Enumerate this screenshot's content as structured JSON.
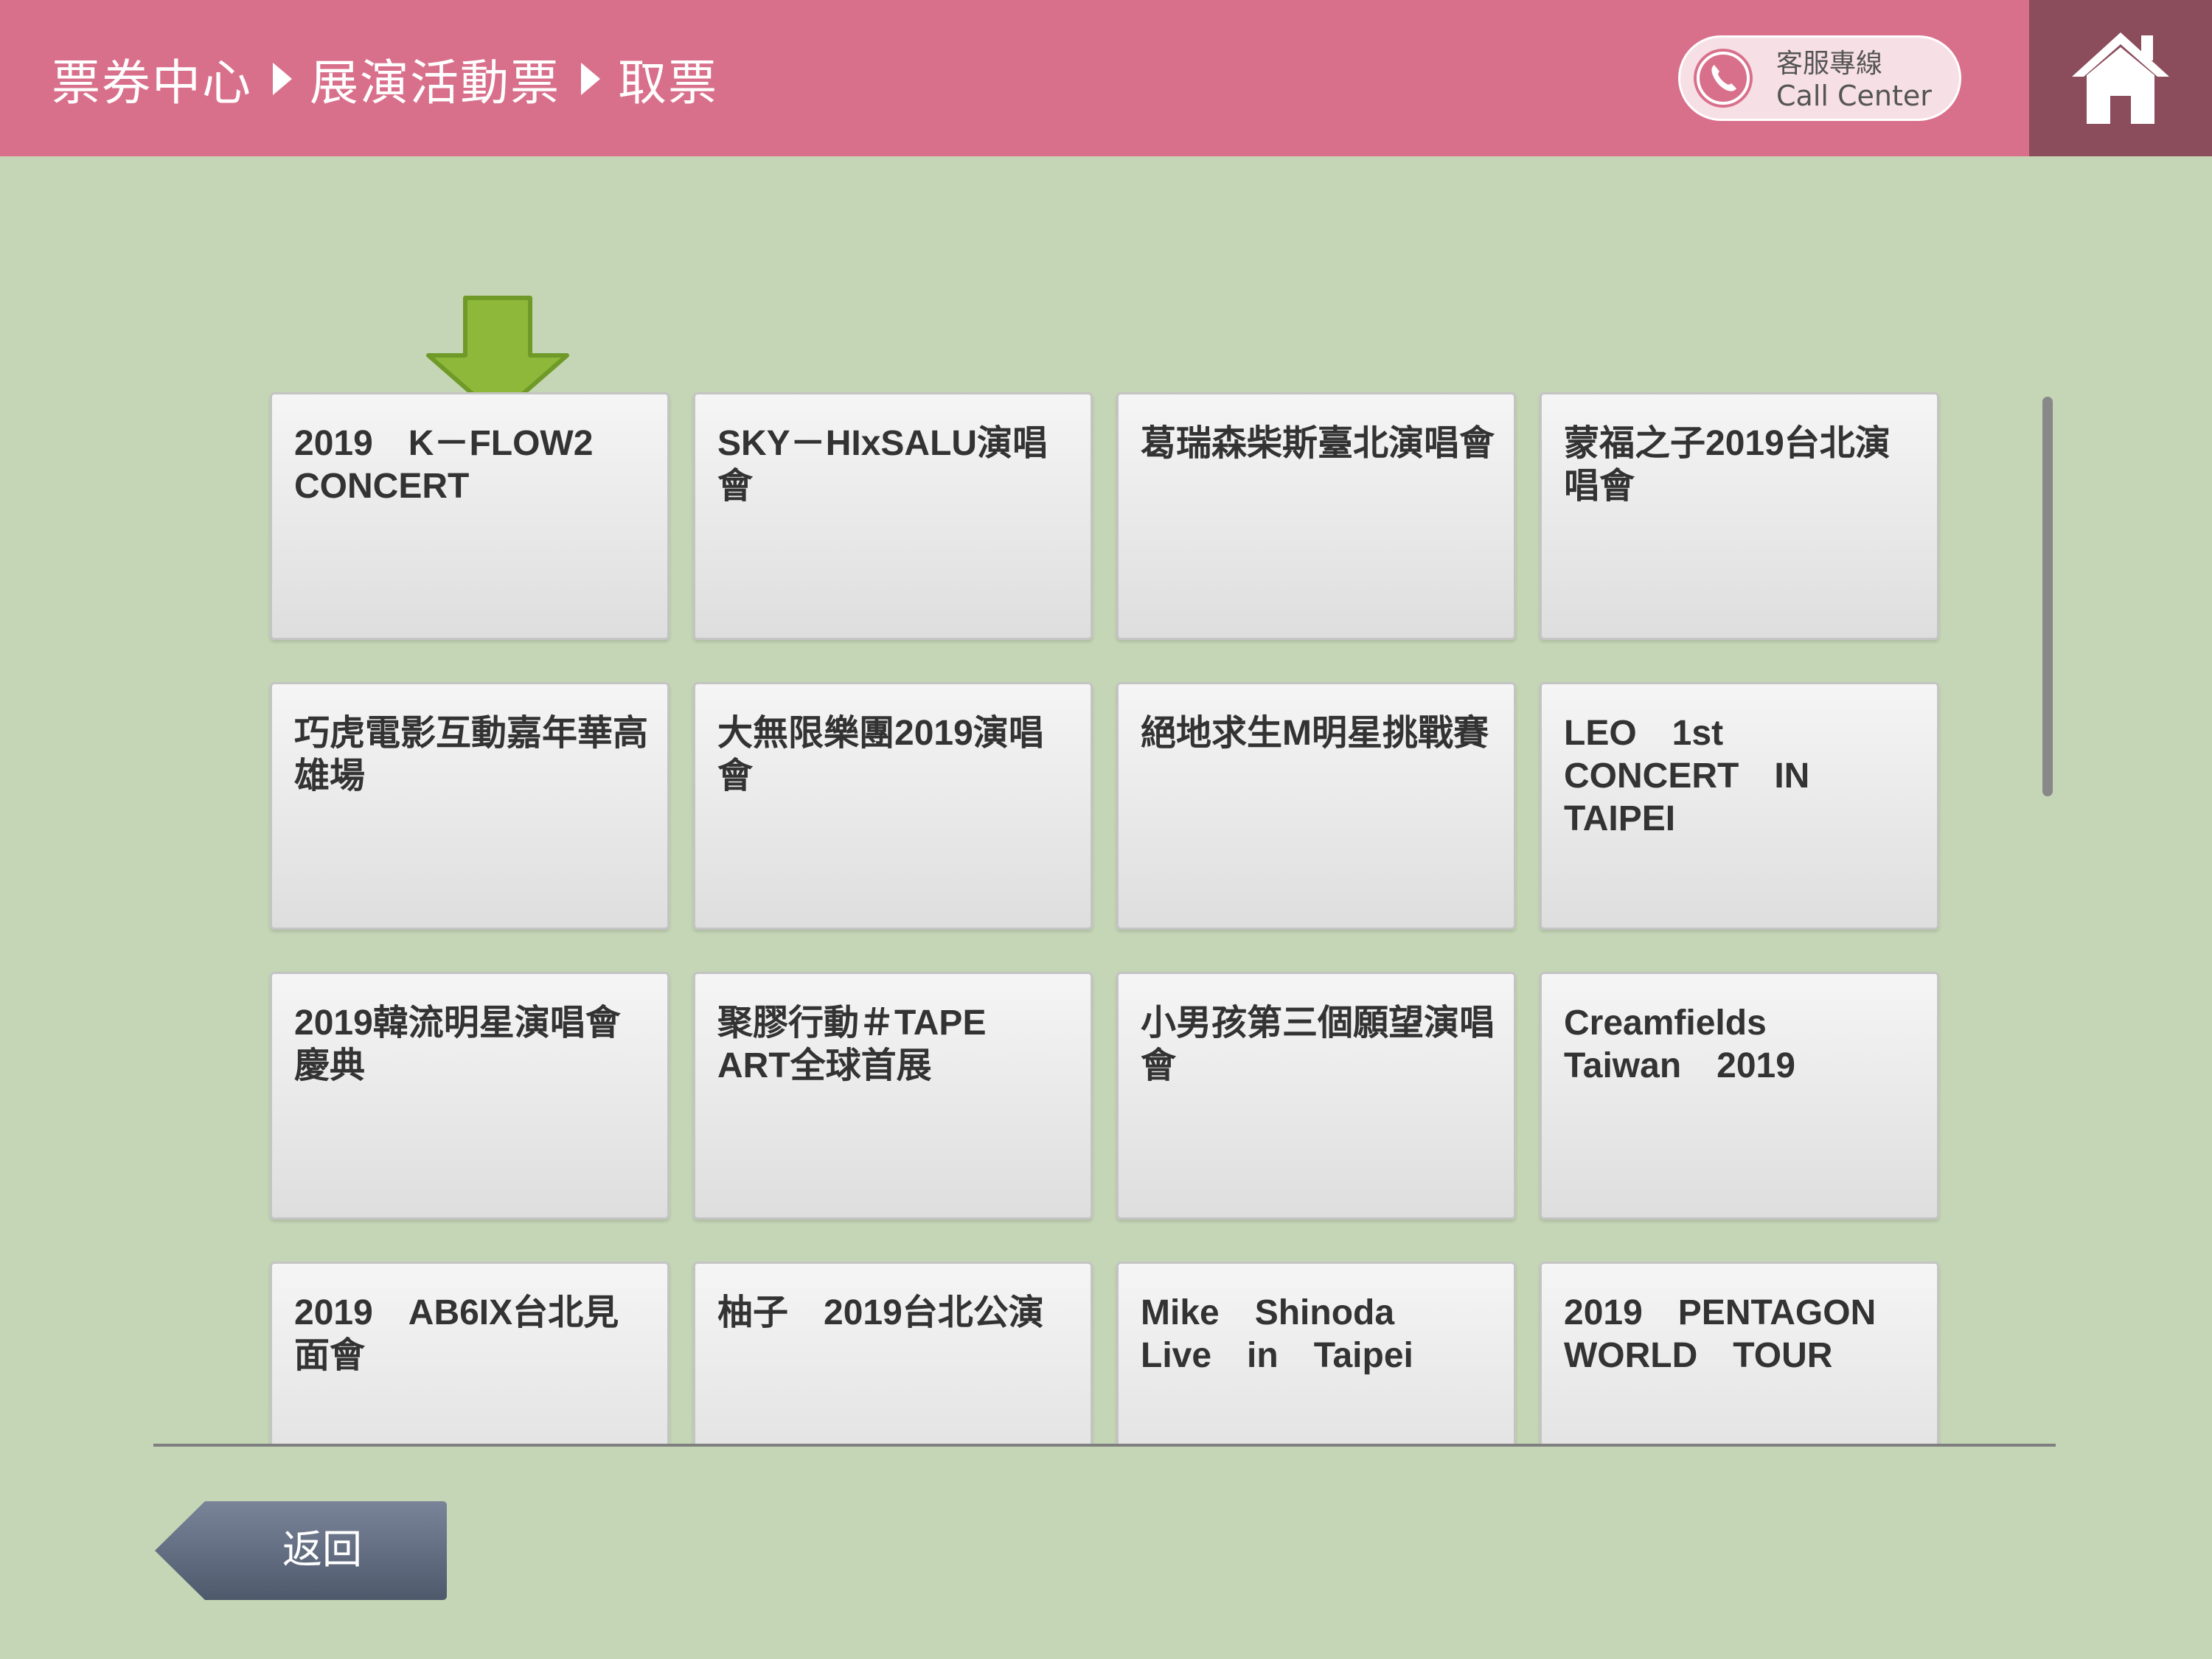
{
  "header": {
    "breadcrumb": [
      "票券中心",
      "展演活動票",
      "取票"
    ],
    "call_center": {
      "label_zh": "客服專線",
      "label_en": "Call Center"
    },
    "home_icon": "home-icon"
  },
  "events": [
    {
      "label": "2019　K－FLOW2\nCONCERT"
    },
    {
      "label": "SKY－HIxSALU演唱會"
    },
    {
      "label": "葛瑞森柴斯臺北演唱會"
    },
    {
      "label": "蒙福之子2019台北演唱會"
    },
    {
      "label": "巧虎電影互動嘉年華高雄場"
    },
    {
      "label": "大無限樂團2019演唱會"
    },
    {
      "label": "絕地求生M明星挑戰賽"
    },
    {
      "label": "LEO　1st\nCONCERT　IN\nTAIPEI"
    },
    {
      "label": "2019韓流明星演唱會慶典"
    },
    {
      "label": "聚膠行動＃TAPE\nART全球首展"
    },
    {
      "label": "小男孩第三個願望演唱會"
    },
    {
      "label": "Creamfields\nTaiwan　2019"
    },
    {
      "label": "2019　AB6IX台北見面會"
    },
    {
      "label": "柚子　2019台北公演"
    },
    {
      "label": "Mike　Shinoda\nLive　in　Taipei"
    },
    {
      "label": "2019　PENTAGON\nWORLD　TOUR"
    }
  ],
  "footer": {
    "back_label": "返回"
  },
  "colors": {
    "header_bg": "#d9708b",
    "home_bg": "#8b4c5c",
    "page_bg": "#c5d6b6",
    "arrow": "#8db83a",
    "back_button": "#606b80"
  }
}
